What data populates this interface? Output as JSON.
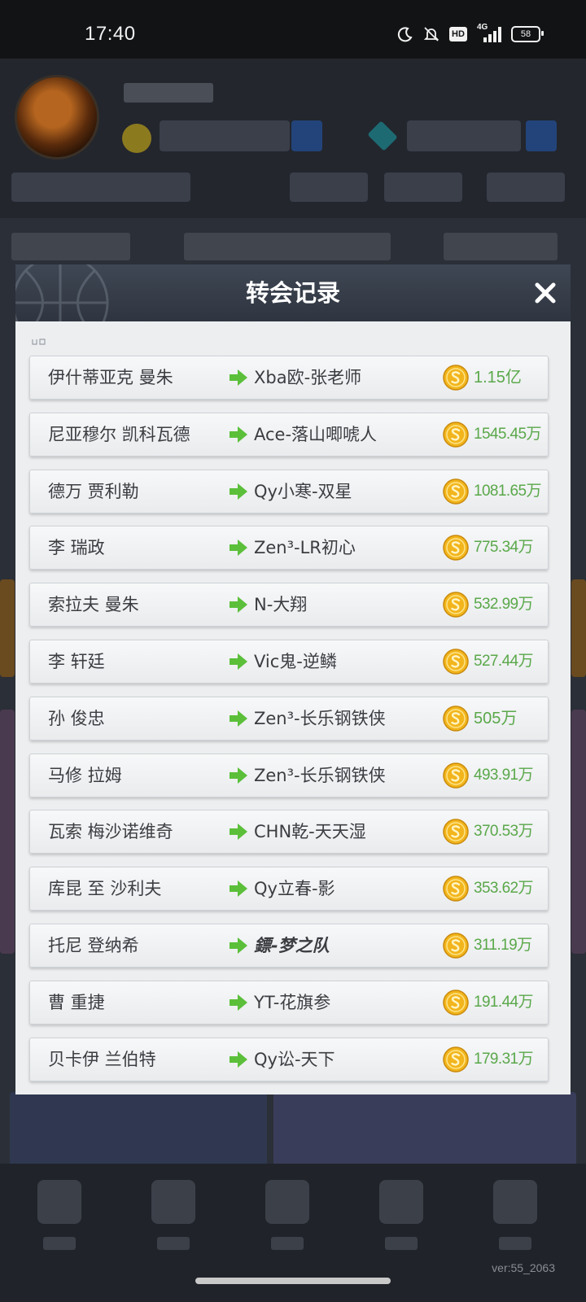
{
  "status_bar": {
    "time": "17:40",
    "icons": [
      "moon-icon",
      "bell-off-icon",
      "hd-icon",
      "signal-4g-icon"
    ],
    "hd_label": "HD",
    "network_label": "4G",
    "battery_level": "58"
  },
  "modal": {
    "title": "转会记录",
    "close_icon": "close-icon",
    "coin_icon": "coin-icon",
    "arrow_icon": "arrow-right-icon",
    "transfers": [
      {
        "player": "伊什蒂亚克 曼朱",
        "club": "Xba欧-张老师",
        "fee": "1.15亿"
      },
      {
        "player": "尼亚穆尔 凯科瓦德",
        "club": "Ace-落山唧唬人",
        "fee": "1545.45万"
      },
      {
        "player": "德万 贾利勒",
        "club": "Qy小寒-双星",
        "fee": "1081.65万"
      },
      {
        "player": "李 瑞政",
        "club": "Zen³-LR初心",
        "fee": "775.34万"
      },
      {
        "player": "索拉夫 曼朱",
        "club": "N-大翔",
        "fee": "532.99万"
      },
      {
        "player": "李 轩廷",
        "club": "Vic鬼-逆鳞",
        "fee": "527.44万"
      },
      {
        "player": "孙 俊忠",
        "club": "Zen³-长乐钢铁侠",
        "fee": "505万"
      },
      {
        "player": "马修 拉姆",
        "club": "Zen³-长乐钢铁侠",
        "fee": "493.91万"
      },
      {
        "player": "瓦索 梅沙诺维奇",
        "club": "CHN乾-天天湿",
        "fee": "370.53万"
      },
      {
        "player": "库昆 至 沙利夫",
        "club": "Qy立春-影",
        "fee": "353.62万"
      },
      {
        "player": "托尼 登纳希",
        "club": "鏢-梦之队",
        "fee": "311.19万"
      },
      {
        "player": "曹 重捷",
        "club": "YT-花旗参",
        "fee": "191.44万"
      },
      {
        "player": "贝卡伊 兰伯特",
        "club": "Qy讼-天下",
        "fee": "179.31万"
      }
    ]
  },
  "footer": {
    "version": "ver:55_2063"
  },
  "colors": {
    "fee_green": "#5aa84a",
    "arrow_green": "#5bbf3a",
    "coin_gold": "#f2b51c",
    "header_dark": "#343b46"
  }
}
